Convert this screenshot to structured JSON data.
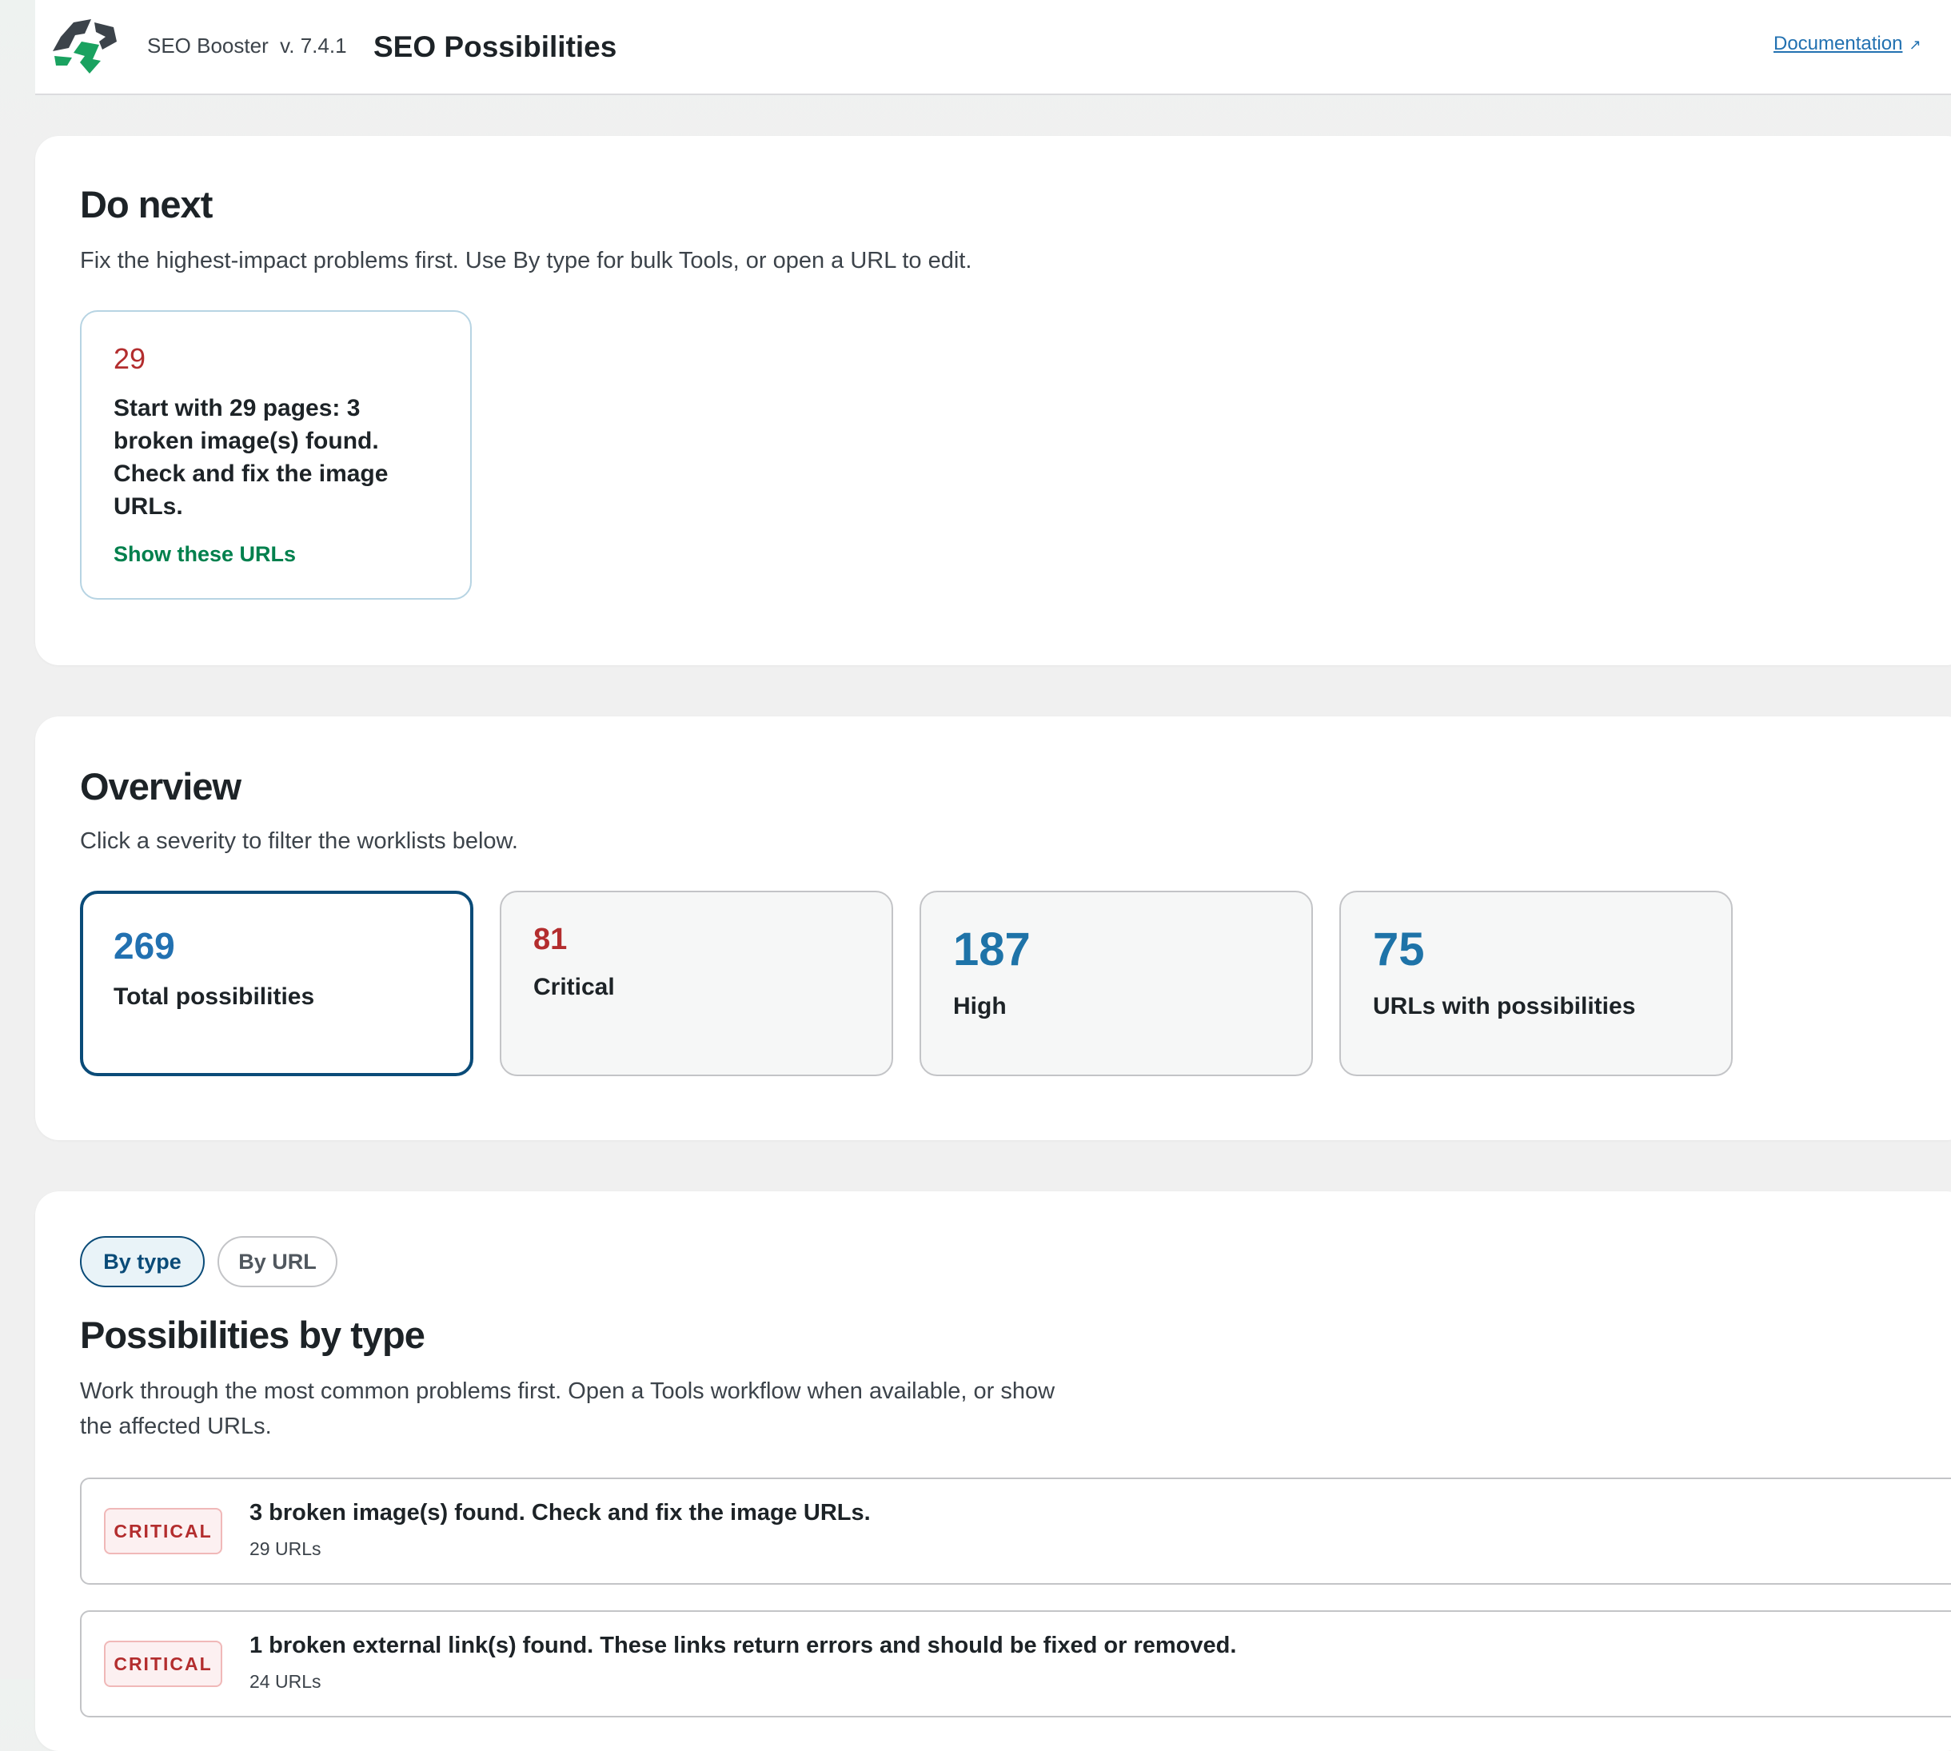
{
  "header": {
    "product": "SEO Booster  v. 7.4.1",
    "title": "SEO Possibilities",
    "doc_link": "Documentation",
    "doc_link_icon": "external-link-icon",
    "next_link_partial": "R"
  },
  "do_next": {
    "heading": "Do next",
    "subtitle": "Fix the highest-impact problems first. Use By type for bulk Tools, or open a URL to edit.",
    "item": {
      "count": "29",
      "text": "Start with 29 pages: 3 broken image(s) found. Check and fix the image URLs.",
      "link": "Show these URLs"
    }
  },
  "overview": {
    "heading": "Overview",
    "subtitle": "Click a severity to filter the worklists below.",
    "stats": [
      {
        "value": "269",
        "label": "Total possibilities",
        "color": "#2271b1"
      },
      {
        "value": "81",
        "label": "Critical",
        "color": "#b32d2e"
      },
      {
        "value": "187",
        "label": "High",
        "color": "#1e73a8"
      },
      {
        "value": "75",
        "label": "URLs with possibilities",
        "color": "#1e73a8"
      }
    ]
  },
  "by_type": {
    "tabs": [
      "By type",
      "By URL"
    ],
    "heading": "Possibilities by type",
    "subtitle": "Work through the most common problems first. Open a Tools workflow when available, or show the affected URLs.",
    "rows": [
      {
        "severity": "CRITICAL",
        "title": "3 broken image(s) found. Check and fix the image URLs.",
        "meta": "29 URLs"
      },
      {
        "severity": "CRITICAL",
        "title": "1 broken external link(s) found. These links return errors and should be fixed or removed.",
        "meta": "24 URLs"
      }
    ]
  },
  "colors": {
    "accent": "#0a4b78",
    "critical": "#b32d2e",
    "link_green": "#00804d"
  }
}
